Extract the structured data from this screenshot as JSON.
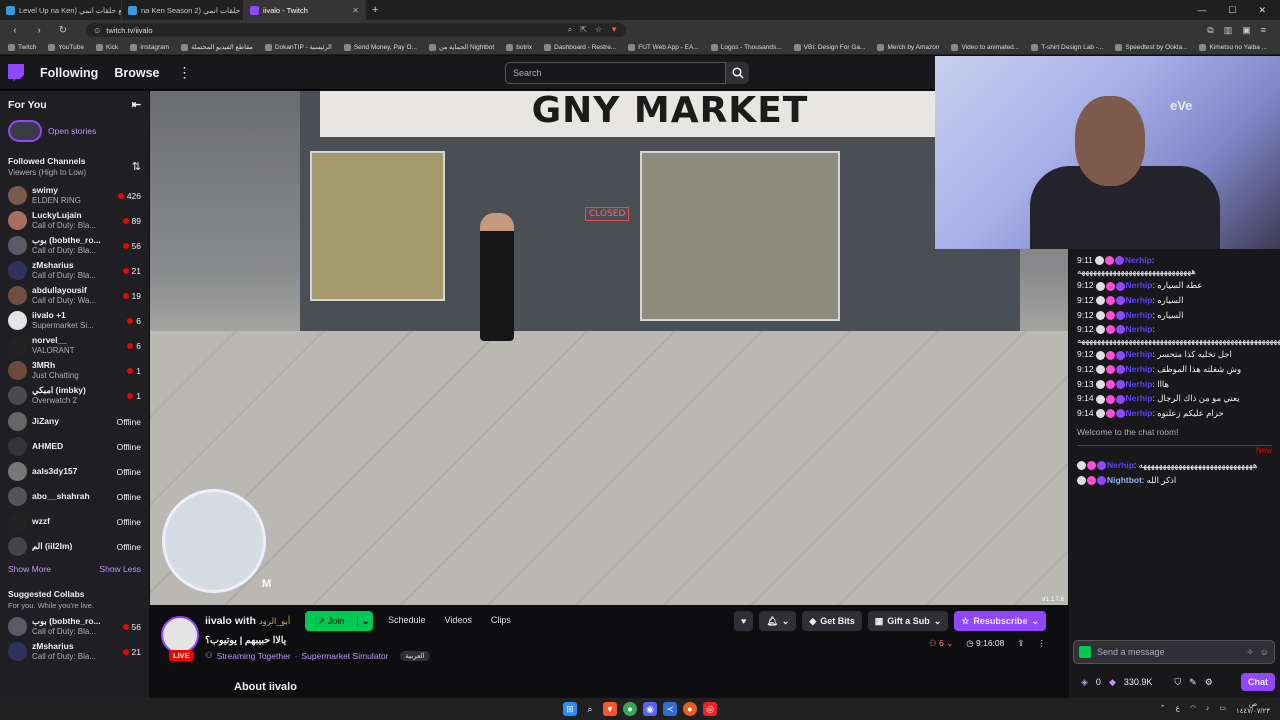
{
  "browser": {
    "tabs": [
      {
        "label": "Level Up na Ken) جميع حلقات انمي",
        "active": false
      },
      {
        "label": "na Ken Season 2) جميع حلقات انمي",
        "active": false
      },
      {
        "label": "iivalo - Twitch",
        "active": true
      }
    ],
    "url": "twitch.tv/iivalo",
    "bookmarks": [
      "Twitch",
      "YouTube",
      "Kick",
      "Instagram",
      "مقاطع الفيديو المحتملة",
      "DokanTIP - الرئيسية",
      "Send Money, Pay O...",
      "الحماية من Nightbot",
      "botrix",
      "Dashboard - Restre...",
      "FUT Web App - EA...",
      "Logos - Thousands...",
      "VBI: Design For Ga...",
      "Merch by Amazon",
      "Video to animated...",
      "T-shirt Design Lab -...",
      "Speedtest by Ookla...",
      "Kimetsu no Yaiba ..."
    ]
  },
  "topnav": {
    "following": "Following",
    "browse": "Browse",
    "search_placeholder": "Search"
  },
  "sidebar": {
    "title": "For You",
    "stories": "Open stories",
    "followed_title": "Followed Channels",
    "followed_sort": "Viewers (High to Low)",
    "channels": [
      {
        "name": "swimy",
        "game": "ELDEN RING",
        "viewers": "426",
        "avatar": "#7b5a4e"
      },
      {
        "name": "LuckyLujain",
        "game": "Call of Duty: Bla...",
        "viewers": "89",
        "avatar": "#a86d63"
      },
      {
        "name": "بوب (bobthe_ro...",
        "game": "Call of Duty: Bla...",
        "viewers": "56",
        "avatar": "#5b5b66"
      },
      {
        "name": "zMsharius",
        "game": "Call of Duty: Bla...",
        "viewers": "21",
        "avatar": "#30305a"
      },
      {
        "name": "abdullayousif",
        "game": "Call of Duty: Wa...",
        "viewers": "19",
        "avatar": "#6d5040"
      },
      {
        "name": "iivalo +1",
        "game": "Supermarket Si...",
        "viewers": "6",
        "avatar": "#e5e5e5"
      },
      {
        "name": "norvel__",
        "game": "VALORANT",
        "viewers": "6",
        "avatar": "#222"
      },
      {
        "name": "3MRh",
        "game": "Just Chatting",
        "viewers": "1",
        "avatar": "#6a4b3c"
      },
      {
        "name": "امبكي (imbky)",
        "game": "Overwatch 2",
        "viewers": "1",
        "avatar": "#4a4a4a"
      }
    ],
    "offline": [
      {
        "name": "JiZany",
        "status": "Offline",
        "avatar": "#666"
      },
      {
        "name": "AHMED",
        "status": "Offline",
        "avatar": "#333"
      },
      {
        "name": "aals3dy157",
        "status": "Offline",
        "avatar": "#777"
      },
      {
        "name": "abo__shahrah",
        "status": "Offline",
        "avatar": "#555"
      },
      {
        "name": "wzzf",
        "status": "Offline",
        "avatar": "#222"
      },
      {
        "name": "الم (iiI2Im)",
        "status": "Offline",
        "avatar": "#444"
      }
    ],
    "show_more": "Show More",
    "show_less": "Show Less",
    "collabs_title": "Suggested Collabs",
    "collabs_sub": "For you. While you're live.",
    "collabs": [
      {
        "name": "بوب (bobthe_ro...",
        "game": "Call of Duty: Bla...",
        "viewers": "56",
        "avatar": "#5b5b66"
      },
      {
        "name": "zMsharius",
        "game": "Call of Duty: Bla...",
        "viewers": "21",
        "avatar": "#30305a"
      }
    ]
  },
  "player": {
    "store_sign": "GNY MARKET",
    "closed_sign": "CLOSED",
    "map_key": "M",
    "overlay": "V1.1.7.6"
  },
  "webcam": {
    "logo": "eVe"
  },
  "stream": {
    "channel": "iivalo",
    "with": "with",
    "collab": "أبو_الرود",
    "join": "Join",
    "tabs": [
      "Schedule",
      "Videos",
      "Clips"
    ],
    "title": "يالاا حبيبهم | يوتيوب؟",
    "live": "LIVE",
    "together": "Streaming Together",
    "game": "Supermarket Simulator",
    "tag": "العربية",
    "about": "About iivalo",
    "get_bits": "Get Bits",
    "gift": "Gift a Sub",
    "resub": "Resubscribe",
    "viewers": "6",
    "uptime": "9:16:08"
  },
  "chat": {
    "messages": [
      {
        "time": "9:11",
        "user": "Nerhip",
        "text": "هههههههههههههههههههههههههههههه"
      },
      {
        "time": "9:12",
        "user": "Nerhip",
        "text": "عطه السياره"
      },
      {
        "time": "9:12",
        "user": "Nerhip",
        "text": "السياره"
      },
      {
        "time": "9:12",
        "user": "Nerhip",
        "text": "السياره"
      },
      {
        "time": "9:12",
        "user": "Nerhip",
        "text": "ههههههههههههههههههههههههههههههههههههههههههههههههههههههههههههه"
      },
      {
        "time": "9:12",
        "user": "Nerhip",
        "text": "اجل تخليه كذا متحسر"
      },
      {
        "time": "9:12",
        "user": "Nerhip",
        "text": "وش شغلته هذا الموظف"
      },
      {
        "time": "9:13",
        "user": "Nerhip",
        "text": "هااا"
      },
      {
        "time": "9:14",
        "user": "Nerhip",
        "text": "يعني مو من ذاك الرجال"
      },
      {
        "time": "9:14",
        "user": "Nerhip",
        "text": "حرام عليكم زعلتوه"
      }
    ],
    "welcome": "Welcome to the chat room!",
    "new_label": "New",
    "new_messages": [
      {
        "user": "Nerhip",
        "text": "هههههههههههههههههههههههههههههه"
      },
      {
        "user": "Nightbot",
        "text": "اذكر الله"
      }
    ],
    "placeholder": "Send a message",
    "points": "0",
    "bits": "330.9K",
    "chat_btn": "Chat"
  },
  "taskbar": {
    "time": "ص",
    "date": "١٤٤٧/٠٧/٢٣"
  }
}
